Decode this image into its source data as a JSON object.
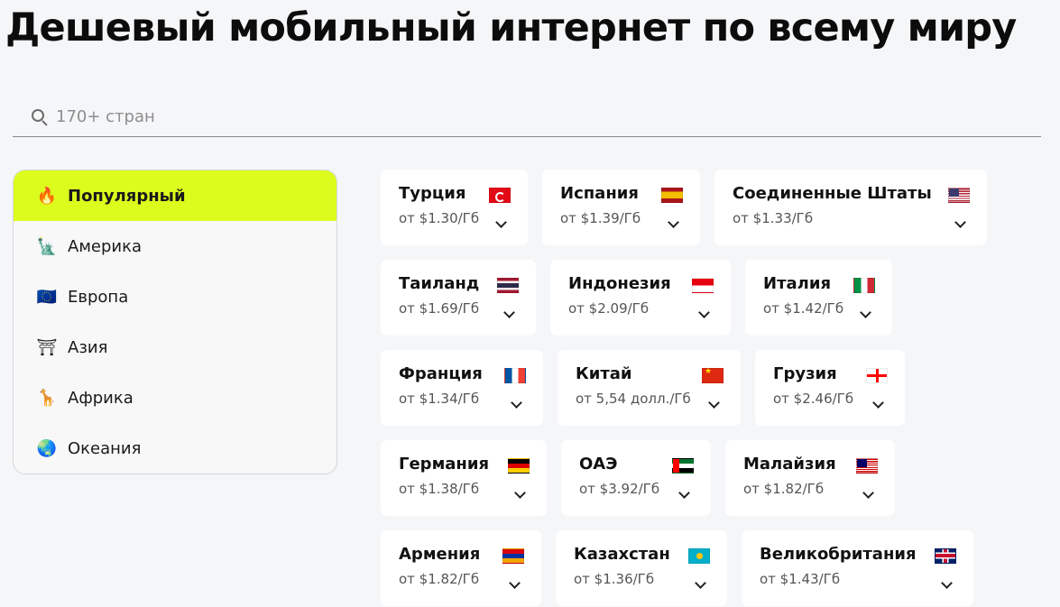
{
  "page": {
    "title": "Дешевый мобильный интернет по всему миру"
  },
  "search": {
    "placeholder": "170+ стран",
    "icon": "search-icon"
  },
  "sidebar": {
    "items": [
      {
        "emoji": "🔥",
        "icon": "fire-icon",
        "label": "Популярный",
        "active": true
      },
      {
        "emoji": "🗽",
        "icon": "statue-of-liberty-icon",
        "label": "Америка",
        "active": false
      },
      {
        "emoji": "🇪🇺",
        "icon": "eu-flag-icon",
        "label": "Европа",
        "active": false
      },
      {
        "emoji": "⛩",
        "icon": "torii-gate-icon",
        "label": "Азия",
        "active": false
      },
      {
        "emoji": "🦒",
        "icon": "giraffe-icon",
        "label": "Африка",
        "active": false
      },
      {
        "emoji": "🌏",
        "icon": "globe-icon",
        "label": "Океания",
        "active": false
      }
    ],
    "accent_color": "#dcfc1d"
  },
  "countries": [
    {
      "name": "Турция",
      "price": "от $1.30/Гб",
      "flag": "tr"
    },
    {
      "name": "Испания",
      "price": "от $1.39/Гб",
      "flag": "es"
    },
    {
      "name": "Соединенные Штаты",
      "price": "от $1.33/Гб",
      "flag": "us"
    },
    {
      "name": "Таиланд",
      "price": "от $1.69/Гб",
      "flag": "th"
    },
    {
      "name": "Индонезия",
      "price": "от $2.09/Гб",
      "flag": "id"
    },
    {
      "name": "Италия",
      "price": "от $1.42/Гб",
      "flag": "it"
    },
    {
      "name": "Франция",
      "price": "от $1.34/Гб",
      "flag": "fr"
    },
    {
      "name": "Китай",
      "price": "от 5,54 долл./Гб",
      "flag": "cn"
    },
    {
      "name": "Грузия",
      "price": "от $2.46/Гб",
      "flag": "ge"
    },
    {
      "name": "Германия",
      "price": "от $1.38/Гб",
      "flag": "de"
    },
    {
      "name": "ОАЭ",
      "price": "от $3.92/Гб",
      "flag": "ae"
    },
    {
      "name": "Малайзия",
      "price": "от $1.82/Гб",
      "flag": "my"
    },
    {
      "name": "Армения",
      "price": "от $1.82/Гб",
      "flag": "am"
    },
    {
      "name": "Казахстан",
      "price": "от $1.36/Гб",
      "flag": "kz"
    },
    {
      "name": "Великобритания",
      "price": "от $1.43/Гб",
      "flag": "gb"
    }
  ]
}
